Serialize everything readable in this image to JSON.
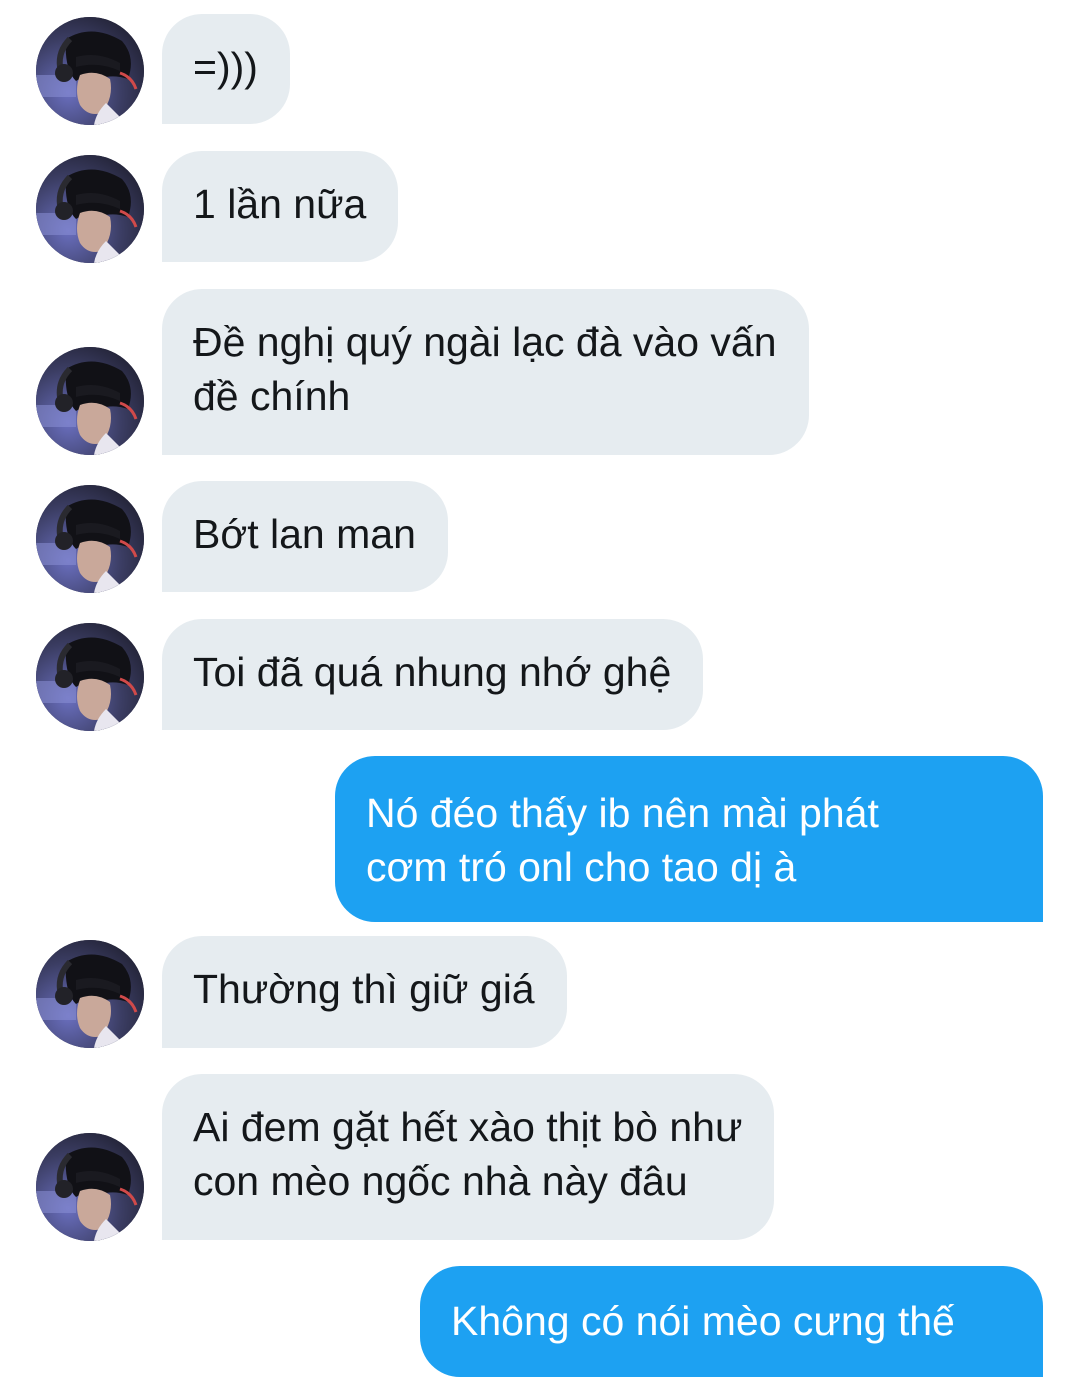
{
  "conversation": {
    "messages": [
      {
        "sender": "other",
        "text": "=)))"
      },
      {
        "sender": "other",
        "text": "1 lần nữa"
      },
      {
        "sender": "other",
        "text": "Đề nghị quý ngài lạc đà vào vấn\nđề chính"
      },
      {
        "sender": "other",
        "text": "Bớt lan man"
      },
      {
        "sender": "other",
        "text": "Toi đã quá nhung nhớ ghệ"
      },
      {
        "sender": "me",
        "text": "Nó đéo thấy ib nên mài phát\ncơm tró onl cho tao dị à"
      },
      {
        "sender": "other",
        "text": "Thường thì giữ giá"
      },
      {
        "sender": "other",
        "text": "Ai đem gặt hết xào thịt bò như\ncon mèo ngốc nhà này đâu"
      },
      {
        "sender": "me",
        "text": "Không có nói mèo cưng thế"
      }
    ]
  },
  "theme": {
    "incoming_bubble": "#e6ecf0",
    "outgoing_bubble": "#1da1f2",
    "incoming_text": "#14171a",
    "outgoing_text": "#ffffff"
  },
  "icons": {
    "avatar": "user-avatar-photo"
  }
}
